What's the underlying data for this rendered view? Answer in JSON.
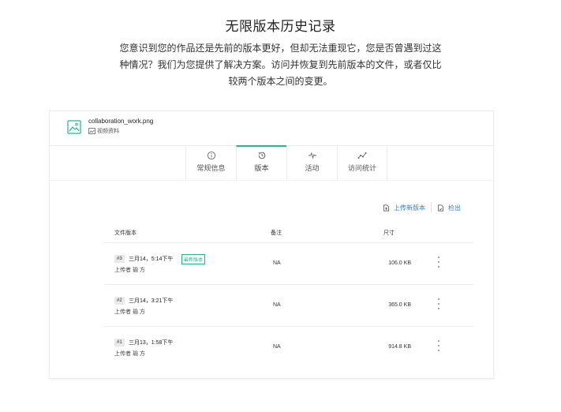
{
  "hero": {
    "title": "无限版本历史记录",
    "description": "您意识到您的作品还是先前的版本更好，但却无法重现它，您是否曾遇到过这种情况？我们为您提供了解决方案。访问并恢复到先前版本的文件，或者仅比较两个版本之间的变更。"
  },
  "file": {
    "name": "collaboration_work.png",
    "type_label": "视频资料",
    "thumb_icon": "image-file-icon"
  },
  "tabs": [
    {
      "label": "常规信息",
      "icon": "info-icon"
    },
    {
      "label": "版本",
      "icon": "history-icon"
    },
    {
      "label": "活动",
      "icon": "activity-icon"
    },
    {
      "label": "访问统计",
      "icon": "stats-icon"
    }
  ],
  "active_tab": "版本",
  "actions": {
    "upload_label": "上传新版本",
    "checkout_label": "检出"
  },
  "table": {
    "headers": {
      "version": "文件版本",
      "note": "备注",
      "size": "尺寸"
    },
    "rows": [
      {
        "badge": "#3",
        "date": "三月14，5:14下午",
        "latest": "最新版本",
        "uploader": "上传者 瑜 方",
        "note": "NA",
        "size": "106.0 KB"
      },
      {
        "badge": "#2",
        "date": "三月14，3:21下午",
        "latest": "",
        "uploader": "上传者 瑜 方",
        "note": "NA",
        "size": "365.0 KB"
      },
      {
        "badge": "#1",
        "date": "三月13，1:58下午",
        "latest": "",
        "uploader": "上传者 瑜 方",
        "note": "NA",
        "size": "914.8 KB"
      }
    ]
  },
  "colors": {
    "accent": "#2bb28e",
    "link": "#2a7fd4"
  }
}
